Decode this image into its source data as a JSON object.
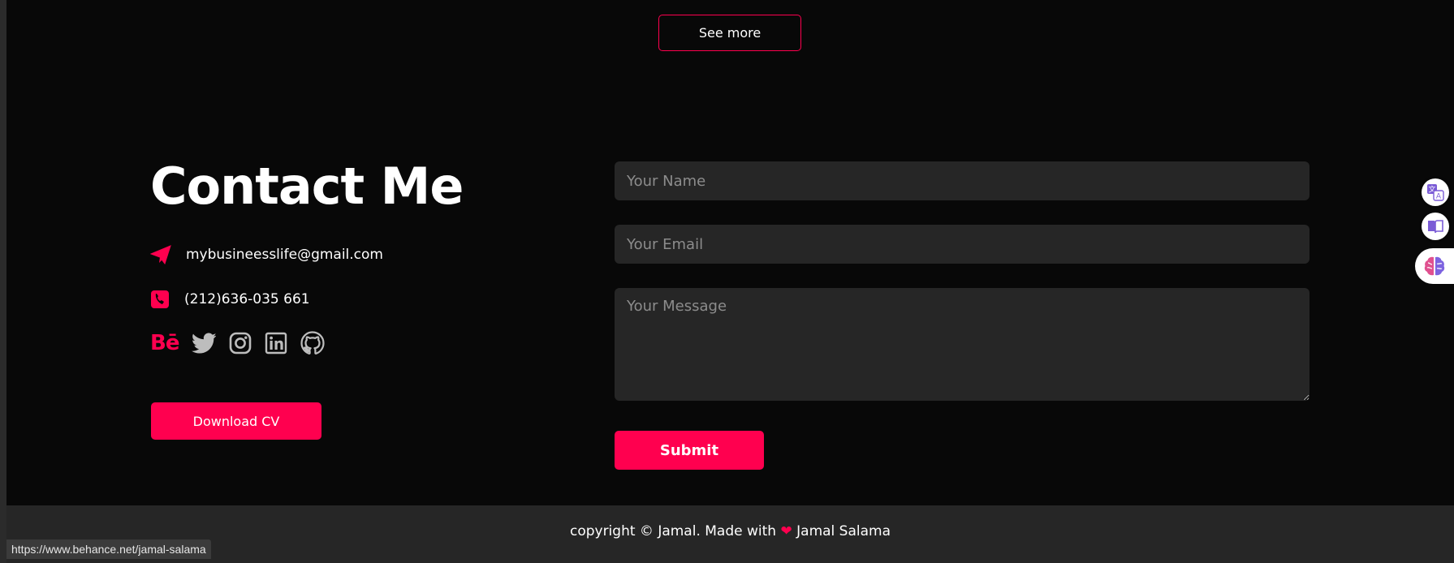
{
  "see_more": {
    "label": "See more"
  },
  "contact": {
    "title": "Contact Me",
    "email": "mybusineesslife@gmail.com",
    "phone": "(212)636-035 661",
    "socials": [
      {
        "name": "behance",
        "label": "Bē"
      },
      {
        "name": "twitter"
      },
      {
        "name": "instagram"
      },
      {
        "name": "linkedin"
      },
      {
        "name": "github"
      }
    ],
    "download_label": "Download CV"
  },
  "form": {
    "name_placeholder": "Your Name",
    "email_placeholder": "Your Email",
    "message_placeholder": "Your Message",
    "submit_label": "Submit"
  },
  "footer": {
    "prefix": "copyright © Jamal. Made with",
    "heart": "❤",
    "suffix": "Jamal Salama"
  },
  "status_bar": {
    "url": "https://www.behance.net/jamal-salama"
  },
  "colors": {
    "accent": "#ff004f",
    "background": "#080808",
    "field": "#262626",
    "footer": "#262626"
  },
  "extensions": [
    {
      "name": "translate-icon"
    },
    {
      "name": "reader-icon"
    },
    {
      "name": "brain-icon"
    }
  ]
}
